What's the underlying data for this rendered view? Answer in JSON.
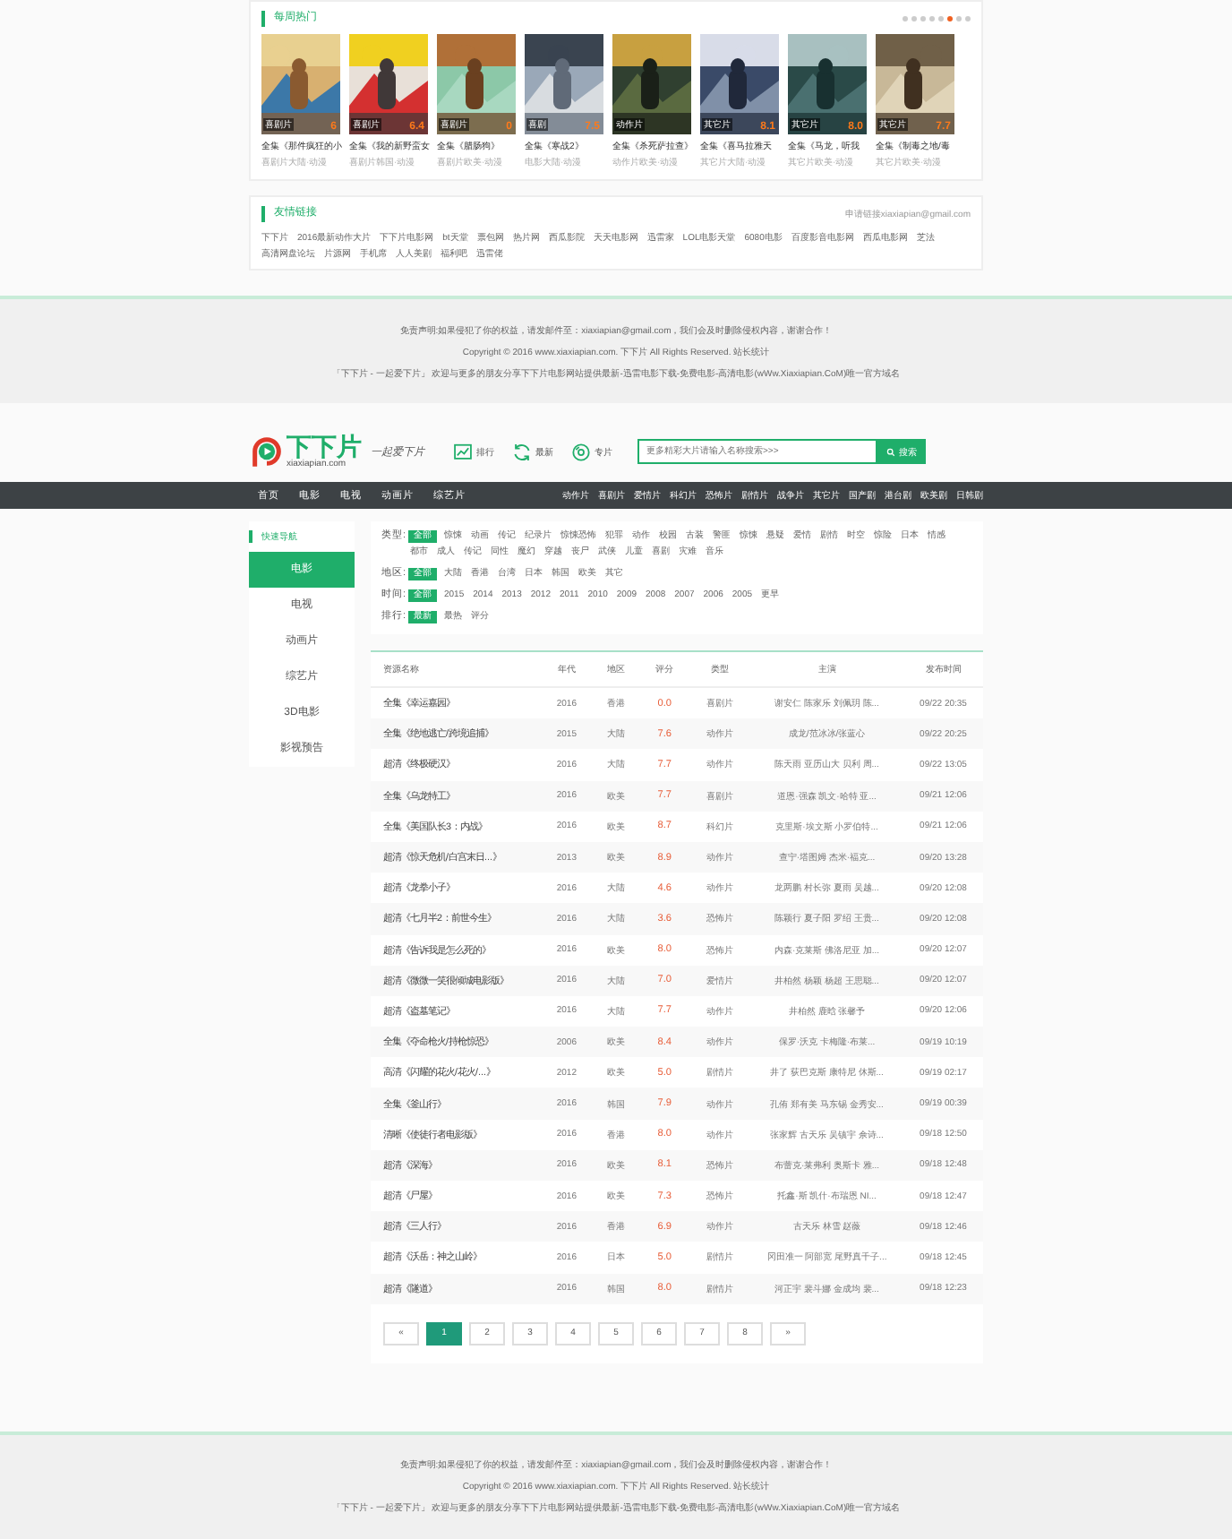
{
  "hot": {
    "title": "每周热门",
    "dots": [
      {
        "selected": false
      },
      {
        "selected": false
      },
      {
        "selected": false
      },
      {
        "selected": false
      },
      {
        "selected": false
      },
      {
        "selected": true
      },
      {
        "selected": false
      },
      {
        "selected": false
      }
    ],
    "movies": [
      {
        "badge": "喜剧片",
        "score": "6",
        "title": "全集《那件疯狂的小",
        "sub": "喜剧片大陆·动漫"
      },
      {
        "badge": "喜剧片",
        "score": "6.4",
        "title": "全集《我的新野蛮女",
        "sub": "喜剧片韩国·动漫"
      },
      {
        "badge": "喜剧片",
        "score": "0",
        "title": "全集《腊肠狗》",
        "sub": "喜剧片欧美·动漫"
      },
      {
        "badge": "喜剧",
        "score": "7.5",
        "title": "全集《寒战2》",
        "sub": "电影大陆·动漫"
      },
      {
        "badge": "动作片",
        "title": "全集《杀死萨拉查》",
        "sub": "动作片欧美·动漫"
      },
      {
        "badge": "其它片",
        "score": "8.1",
        "title": "全集《喜马拉雅天",
        "sub": "其它片大陆·动漫"
      },
      {
        "badge": "其它片",
        "score": "8.0",
        "title": "全集《马龙，听我",
        "sub": "其它片欧美·动漫"
      },
      {
        "badge": "其它片",
        "score": "7.7",
        "title": "全集《制毒之地/毒",
        "sub": "其它片欧美·动漫"
      }
    ]
  },
  "links": {
    "title": "友情链接",
    "apply": "申请链接xiaxiapian@gmail.com",
    "items": [
      "下下片",
      "2016最新动作大片",
      "下下片电影网",
      "bt天堂",
      "票包网",
      "热片网",
      "西瓜影院",
      "天天电影网",
      "迅雷家",
      "LOL电影天堂",
      "6080电影",
      "百度影音电影网",
      "西瓜电影网",
      "芝法",
      "高清网盘论坛",
      "片源网",
      "手机席",
      "人人美剧",
      "福利吧",
      "迅雷佬"
    ]
  },
  "footer_top": [
    "免责声明:如果侵犯了你的权益，请发邮件至：xiaxiapian@gmail.com，我们会及时删除侵权内容，谢谢合作！",
    "Copyright © 2016 www.xiaxiapian.com. 下下片 All Rights Reserved. 站长统计",
    "「下下片 - 一起爱下片」 欢迎与更多的朋友分享下下片电影网站提供最新-迅雷电影下载-免费电影-高清电影(wWw.Xiaxiapian.CoM)唯一官方域名"
  ],
  "header": {
    "logo": "下下片",
    "domain": "xiaxiapian.com",
    "slogan": "一起爱下片",
    "links": [
      {
        "kind": "chart",
        "label": "排行"
      },
      {
        "kind": "refresh",
        "label": "最新"
      },
      {
        "kind": "disc",
        "label": "专片"
      }
    ],
    "search": {
      "placeholder": "更多精彩大片请输入名称搜索>>>",
      "button": "搜索"
    }
  },
  "nav": {
    "main": [
      "首页",
      "电影",
      "电视",
      "动画片",
      "综艺片"
    ],
    "genres": [
      "动作片",
      "喜剧片",
      "爱情片",
      "科幻片",
      "恐怖片",
      "剧情片",
      "战争片",
      "其它片",
      "国产剧",
      "港台剧",
      "欧美剧",
      "日韩剧"
    ]
  },
  "sidebar": {
    "title": "快速导航",
    "items": [
      {
        "label": "电影",
        "selected": true
      },
      {
        "label": "电视",
        "selected": false
      },
      {
        "label": "动画片",
        "selected": false
      },
      {
        "label": "综艺片",
        "selected": false
      },
      {
        "label": "3D电影",
        "selected": false
      },
      {
        "label": "影视预告",
        "selected": false
      }
    ]
  },
  "filters": [
    {
      "label": "类型:",
      "options": [
        {
          "label": "全部",
          "selected": true
        },
        {
          "label": "惊悚",
          "selected": false
        },
        {
          "label": "动画",
          "selected": false
        },
        {
          "label": "传记",
          "selected": false
        },
        {
          "label": "纪录片",
          "selected": false
        },
        {
          "label": "惊悚恐怖",
          "selected": false
        },
        {
          "label": "犯罪",
          "selected": false
        },
        {
          "label": "动作",
          "selected": false
        },
        {
          "label": "校园",
          "selected": false
        },
        {
          "label": "古装",
          "selected": false
        },
        {
          "label": "警匪",
          "selected": false
        },
        {
          "label": "惊悚",
          "selected": false
        },
        {
          "label": "悬疑",
          "selected": false
        },
        {
          "label": "爱情",
          "selected": false
        },
        {
          "label": "剧情",
          "selected": false
        },
        {
          "label": "时空",
          "selected": false
        },
        {
          "label": "惊险",
          "selected": false
        },
        {
          "label": "日本",
          "selected": false
        },
        {
          "label": "情感",
          "selected": false
        },
        {
          "label": "都市",
          "selected": false
        },
        {
          "label": "成人",
          "selected": false
        },
        {
          "label": "传记",
          "selected": false
        },
        {
          "label": "同性",
          "selected": false
        },
        {
          "label": "魔幻",
          "selected": false
        },
        {
          "label": "穿越",
          "selected": false
        },
        {
          "label": "丧尸",
          "selected": false
        },
        {
          "label": "武侠",
          "selected": false
        },
        {
          "label": "儿童",
          "selected": false
        },
        {
          "label": "喜剧",
          "selected": false
        },
        {
          "label": "灾难",
          "selected": false
        },
        {
          "label": "音乐",
          "selected": false
        }
      ]
    },
    {
      "label": "地区:",
      "options": [
        {
          "label": "全部",
          "selected": true
        },
        {
          "label": "大陆",
          "selected": false
        },
        {
          "label": "香港",
          "selected": false
        },
        {
          "label": "台湾",
          "selected": false
        },
        {
          "label": "日本",
          "selected": false
        },
        {
          "label": "韩国",
          "selected": false
        },
        {
          "label": "欧美",
          "selected": false
        },
        {
          "label": "其它",
          "selected": false
        }
      ]
    },
    {
      "label": "时间:",
      "options": [
        {
          "label": "全部",
          "selected": true
        },
        {
          "label": "2015",
          "selected": false
        },
        {
          "label": "2014",
          "selected": false
        },
        {
          "label": "2013",
          "selected": false
        },
        {
          "label": "2012",
          "selected": false
        },
        {
          "label": "2011",
          "selected": false
        },
        {
          "label": "2010",
          "selected": false
        },
        {
          "label": "2009",
          "selected": false
        },
        {
          "label": "2008",
          "selected": false
        },
        {
          "label": "2007",
          "selected": false
        },
        {
          "label": "2006",
          "selected": false
        },
        {
          "label": "2005",
          "selected": false
        },
        {
          "label": "更早",
          "selected": false
        }
      ]
    },
    {
      "label": "排行:",
      "options": [
        {
          "label": "最新",
          "selected": true
        },
        {
          "label": "最热",
          "selected": false
        },
        {
          "label": "评分",
          "selected": false
        }
      ]
    }
  ],
  "table": {
    "columns": [
      "资源名称",
      "年代",
      "地区",
      "评分",
      "类型",
      "主演",
      "发布时间"
    ],
    "rows": [
      [
        "全集《幸运嘉园》",
        "2016",
        "香港",
        "0.0",
        "喜剧片",
        "谢安仁 陈家乐 刘佩玥 陈...",
        "09/22 20:35"
      ],
      [
        "全集《绝地逃亡/跨境追捕》",
        "2015",
        "大陆",
        "7.6",
        "动作片",
        "成龙/范冰冰/张蓝心",
        "09/22 20:25"
      ],
      [
        "超清《终极硬汉》",
        "2016",
        "大陆",
        "7.7",
        "动作片",
        "陈天雨 亚历山大 贝利 周...",
        "09/22 13:05"
      ],
      [
        "全集《乌龙特工》",
        "2016",
        "欧美",
        "7.7",
        "喜剧片",
        "道恩·强森 凯文·哈特 亚...",
        "09/21 12:06"
      ],
      [
        "全集《美国队长3：内战》",
        "2016",
        "欧美",
        "8.7",
        "科幻片",
        "克里斯·埃文斯 小罗伯特...",
        "09/21 12:06"
      ],
      [
        "超清《惊天危机/白宫末日...》",
        "2013",
        "欧美",
        "8.9",
        "动作片",
        "查宁·塔图姆 杰米·福克...",
        "09/20 13:28"
      ],
      [
        "超清《龙拳小子》",
        "2016",
        "大陆",
        "4.6",
        "动作片",
        "龙两鹏 村长弥 夏雨 吴越...",
        "09/20 12:08"
      ],
      [
        "超清《七月半2：前世今生》",
        "2016",
        "大陆",
        "3.6",
        "恐怖片",
        "陈颖行 夏子阳 罗绍 王贵...",
        "09/20 12:08"
      ],
      [
        "超清《告诉我是怎么死的》",
        "2016",
        "欧美",
        "8.0",
        "恐怖片",
        "内森·克莱斯 佛洛尼亚 加...",
        "09/20 12:07"
      ],
      [
        "超清《微微一笑很倾城电影版》",
        "2016",
        "大陆",
        "7.0",
        "爱情片",
        "井柏然 杨颖 杨超 王思聪...",
        "09/20 12:07"
      ],
      [
        "超清《盗墓笔记》",
        "2016",
        "大陆",
        "7.7",
        "动作片",
        "井柏然 鹿晗 张馨予",
        "09/20 12:06"
      ],
      [
        "全集《夺命枪火/持枪惊恐》",
        "2006",
        "欧美",
        "8.4",
        "动作片",
        "保罗·沃克 卡梅隆·布莱...",
        "09/19 10:19"
      ],
      [
        "高清《闪耀的花火/花火/...》",
        "2012",
        "欧美",
        "5.0",
        "剧情片",
        "井了 荻巴克斯 康特尼 休斯...",
        "09/19 02:17"
      ],
      [
        "全集《釜山行》",
        "2016",
        "韩国",
        "7.9",
        "动作片",
        "孔侑 郑有美 马东锡 金秀安...",
        "09/19 00:39"
      ],
      [
        "清晰《使徒行者电影版》",
        "2016",
        "香港",
        "8.0",
        "动作片",
        "张家辉 古天乐 吴镇宇 佘诗...",
        "09/18 12:50"
      ],
      [
        "超清《深海》",
        "2016",
        "欧美",
        "8.1",
        "恐怖片",
        "布蕾克·莱弗利 奥斯卡 雅...",
        "09/18 12:48"
      ],
      [
        "超清《尸屋》",
        "2016",
        "欧美",
        "7.3",
        "恐怖片",
        "托鑫·斯 凯什·布瑞恩 NI...",
        "09/18 12:47"
      ],
      [
        "超清《三人行》",
        "2016",
        "香港",
        "6.9",
        "动作片",
        "古天乐 林雪 赵薇",
        "09/18 12:46"
      ],
      [
        "超清《沃岳：神之山岭》",
        "2016",
        "日本",
        "5.0",
        "剧情片",
        "冈田准一 阿部宽 尾野真千子...",
        "09/18 12:45"
      ],
      [
        "超清《隧道》",
        "2016",
        "韩国",
        "8.0",
        "剧情片",
        "河正宇 裴斗娜 金成均 裴...",
        "09/18 12:23"
      ]
    ]
  },
  "pagination": {
    "prev": "«",
    "pages": [
      {
        "label": "1",
        "selected": true
      },
      {
        "label": "2",
        "selected": false
      },
      {
        "label": "3",
        "selected": false
      },
      {
        "label": "4",
        "selected": false
      },
      {
        "label": "5",
        "selected": false
      },
      {
        "label": "6",
        "selected": false
      },
      {
        "label": "7",
        "selected": false
      },
      {
        "label": "8",
        "selected": false
      }
    ],
    "next": "»"
  },
  "footer_bottom": [
    "免责声明:如果侵犯了你的权益，请发邮件至：xiaxiapian@gmail.com，我们会及时删除侵权内容，谢谢合作！",
    "Copyright © 2016 www.xiaxiapian.com. 下下片 All Rights Reserved. 站长统计",
    "「下下片 - 一起爱下片」 欢迎与更多的朋友分享下下片电影网站提供最新-迅雷电影下载-免费电影-高清电影(wWw.Xiaxiapian.CoM)唯一官方域名"
  ]
}
